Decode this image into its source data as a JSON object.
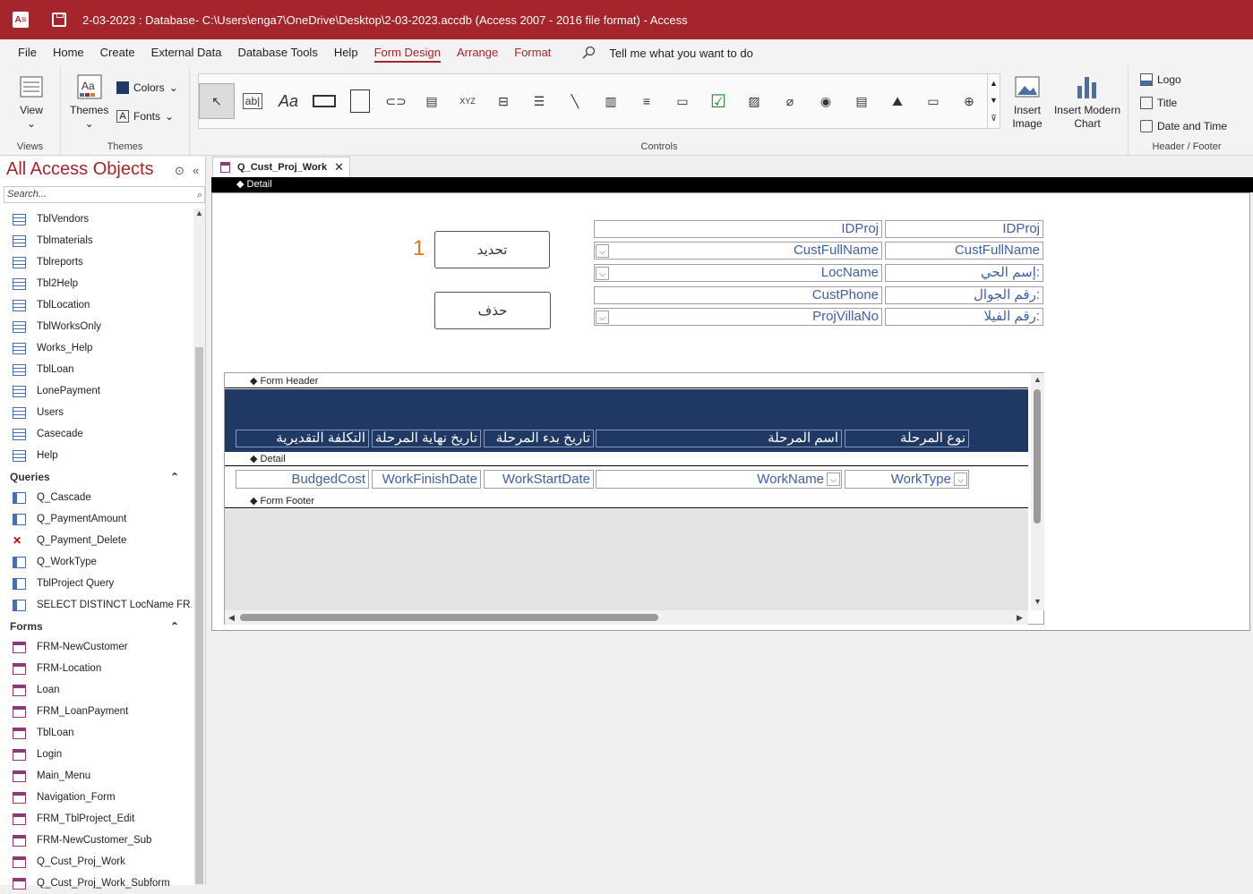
{
  "titlebar": {
    "app_icon": "A≡",
    "title": "2-03-2023 : Database- C:\\Users\\enga7\\OneDrive\\Desktop\\2-03-2023.accdb (Access 2007 - 2016 file format)  -  Access"
  },
  "menu": {
    "tabs": [
      "File",
      "Home",
      "Create",
      "External Data",
      "Database Tools",
      "Help",
      "Form Design",
      "Arrange",
      "Format"
    ],
    "active": "Form Design",
    "tell_me": "Tell me what you want to do"
  },
  "ribbon": {
    "view_label": "View",
    "views_group": "Views",
    "themes_label": "Themes",
    "colors_label": "Colors",
    "fonts_label": "Fonts",
    "themes_group": "Themes",
    "controls_group": "Controls",
    "insert_image_label": "Insert Image",
    "insert_chart_label": "Insert Modern Chart",
    "logo_label": "Logo",
    "title_label": "Title",
    "datetime_label": "Date and Time",
    "header_footer_group": "Header / Footer"
  },
  "nav": {
    "title": "All Access Objects",
    "search_placeholder": "Search...",
    "tables": [
      "TblVendors",
      "Tblmaterials",
      "Tblreports",
      "Tbl2Help",
      "TblLocation",
      "TblWorksOnly",
      "Works_Help",
      "TblLoan",
      "LonePayment",
      "Users",
      "Casecade",
      "Help"
    ],
    "queries_header": "Queries",
    "queries": [
      "Q_Cascade",
      "Q_PaymentAmount",
      "Q_Payment_Delete",
      "Q_WorkType",
      "TblProject Query",
      "SELECT DISTINCT LocName FR..."
    ],
    "forms_header": "Forms",
    "forms": [
      "FRM-NewCustomer",
      "FRM-Location",
      "Loan",
      "FRM_LoanPayment",
      "TblLoan",
      "Login",
      "Main_Menu",
      "Navigation_Form",
      "FRM_TblProject_Edit",
      "FRM-NewCustomer_Sub",
      "Q_Cust_Proj_Work",
      "Q_Cust_Proj_Work_Subform"
    ]
  },
  "document": {
    "tab_label": "Q_Cust_Proj_Work",
    "detail_label": "Detail",
    "fields": [
      {
        "label": "IDProj",
        "value": "IDProj",
        "combo": false
      },
      {
        "label": "CustFullName",
        "value": "CustFullName",
        "combo": true
      },
      {
        "label": "إسم الحي:",
        "value": "LocName",
        "combo": true
      },
      {
        "label": "رقم الجوال:",
        "value": "CustPhone",
        "combo": false
      },
      {
        "label": "رقم الفيلا:",
        "value": "ProjVillaNo",
        "combo": true
      }
    ],
    "select_button": "تحديد",
    "delete_button": "حذف",
    "marker": "1"
  },
  "subform": {
    "form_header": "Form Header",
    "detail": "Detail",
    "form_footer": "Form Footer",
    "columns": [
      {
        "header": "التكلفة التقديرية",
        "field": "BudgedCost",
        "combo": false
      },
      {
        "header": "تاريخ نهاية المرحلة",
        "field": "WorkFinishDate",
        "combo": false
      },
      {
        "header": "تاريخ بدء المرحلة",
        "field": "WorkStartDate",
        "combo": false
      },
      {
        "header": "اسم المرحلة",
        "field": "WorkName",
        "combo": true
      },
      {
        "header": "نوع المرحلة",
        "field": "WorkType",
        "combo": true
      }
    ]
  },
  "colors": {
    "accent": "#a4262c",
    "subform_header": "#1f3864"
  }
}
